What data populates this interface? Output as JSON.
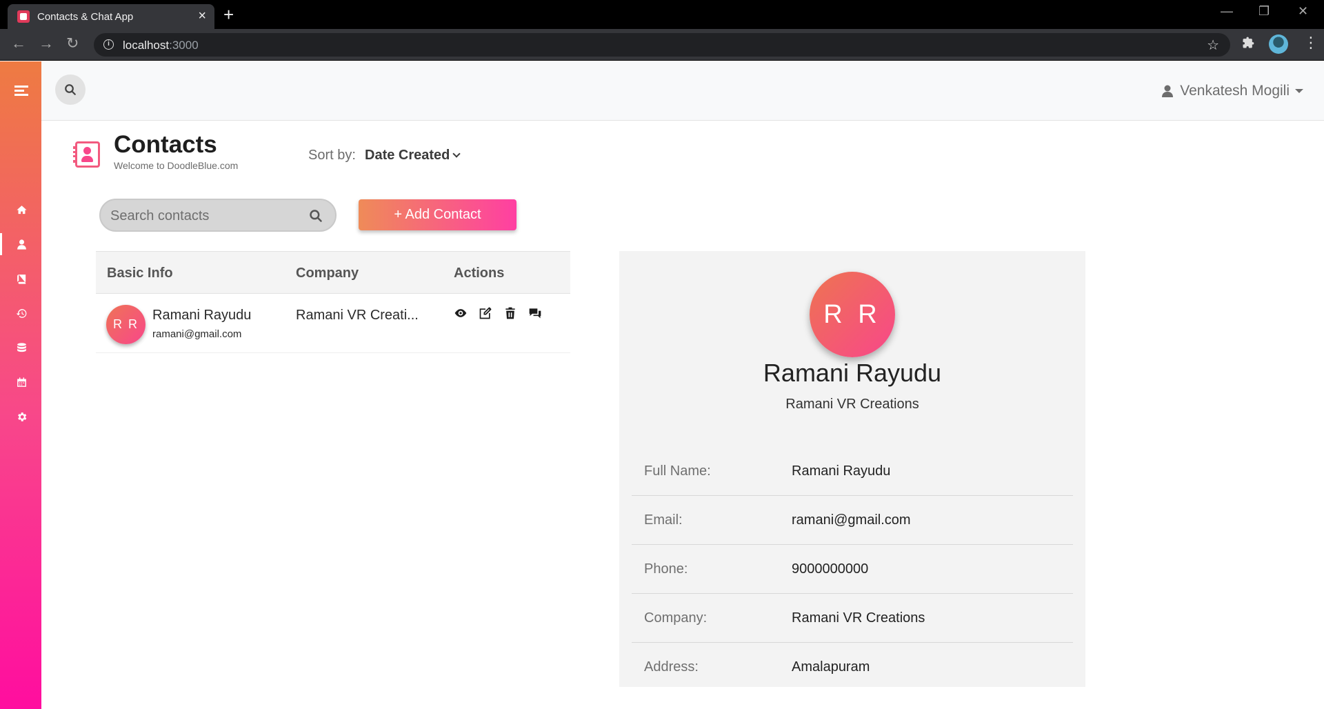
{
  "browser": {
    "tab_title": "Contacts & Chat App",
    "url_host": "localhost",
    "url_port": ":3000"
  },
  "header": {
    "user_name": "Venkatesh Mogili"
  },
  "page": {
    "title": "Contacts",
    "subtitle": "Welcome to DoodleBlue.com",
    "sort_label": "Sort by:",
    "sort_value": "Date Created",
    "search_placeholder": "Search contacts",
    "add_button": "+ Add Contact"
  },
  "sidebar": {
    "items": [
      {
        "icon": "home-icon"
      },
      {
        "icon": "user-icon",
        "active": true
      },
      {
        "icon": "book-icon"
      },
      {
        "icon": "history-icon"
      },
      {
        "icon": "database-icon"
      },
      {
        "icon": "calendar-icon"
      },
      {
        "icon": "gear-icon"
      }
    ]
  },
  "table": {
    "columns": [
      "Basic Info",
      "Company",
      "Actions"
    ],
    "rows": [
      {
        "initials": "R R",
        "name": "Ramani Rayudu",
        "email": "ramani@gmail.com",
        "company": "Ramani VR Creati..."
      }
    ]
  },
  "detail": {
    "initials": "R R",
    "name": "Ramani Rayudu",
    "company": "Ramani VR Creations",
    "fields": [
      {
        "label": "Full Name:",
        "value": "Ramani Rayudu"
      },
      {
        "label": "Email:",
        "value": "ramani@gmail.com"
      },
      {
        "label": "Phone:",
        "value": "9000000000"
      },
      {
        "label": "Company:",
        "value": "Ramani VR Creations"
      },
      {
        "label": "Address:",
        "value": "Amalapuram"
      }
    ]
  },
  "colors": {
    "accent_start": "#ee7b42",
    "accent_end": "#ff0d9f"
  }
}
